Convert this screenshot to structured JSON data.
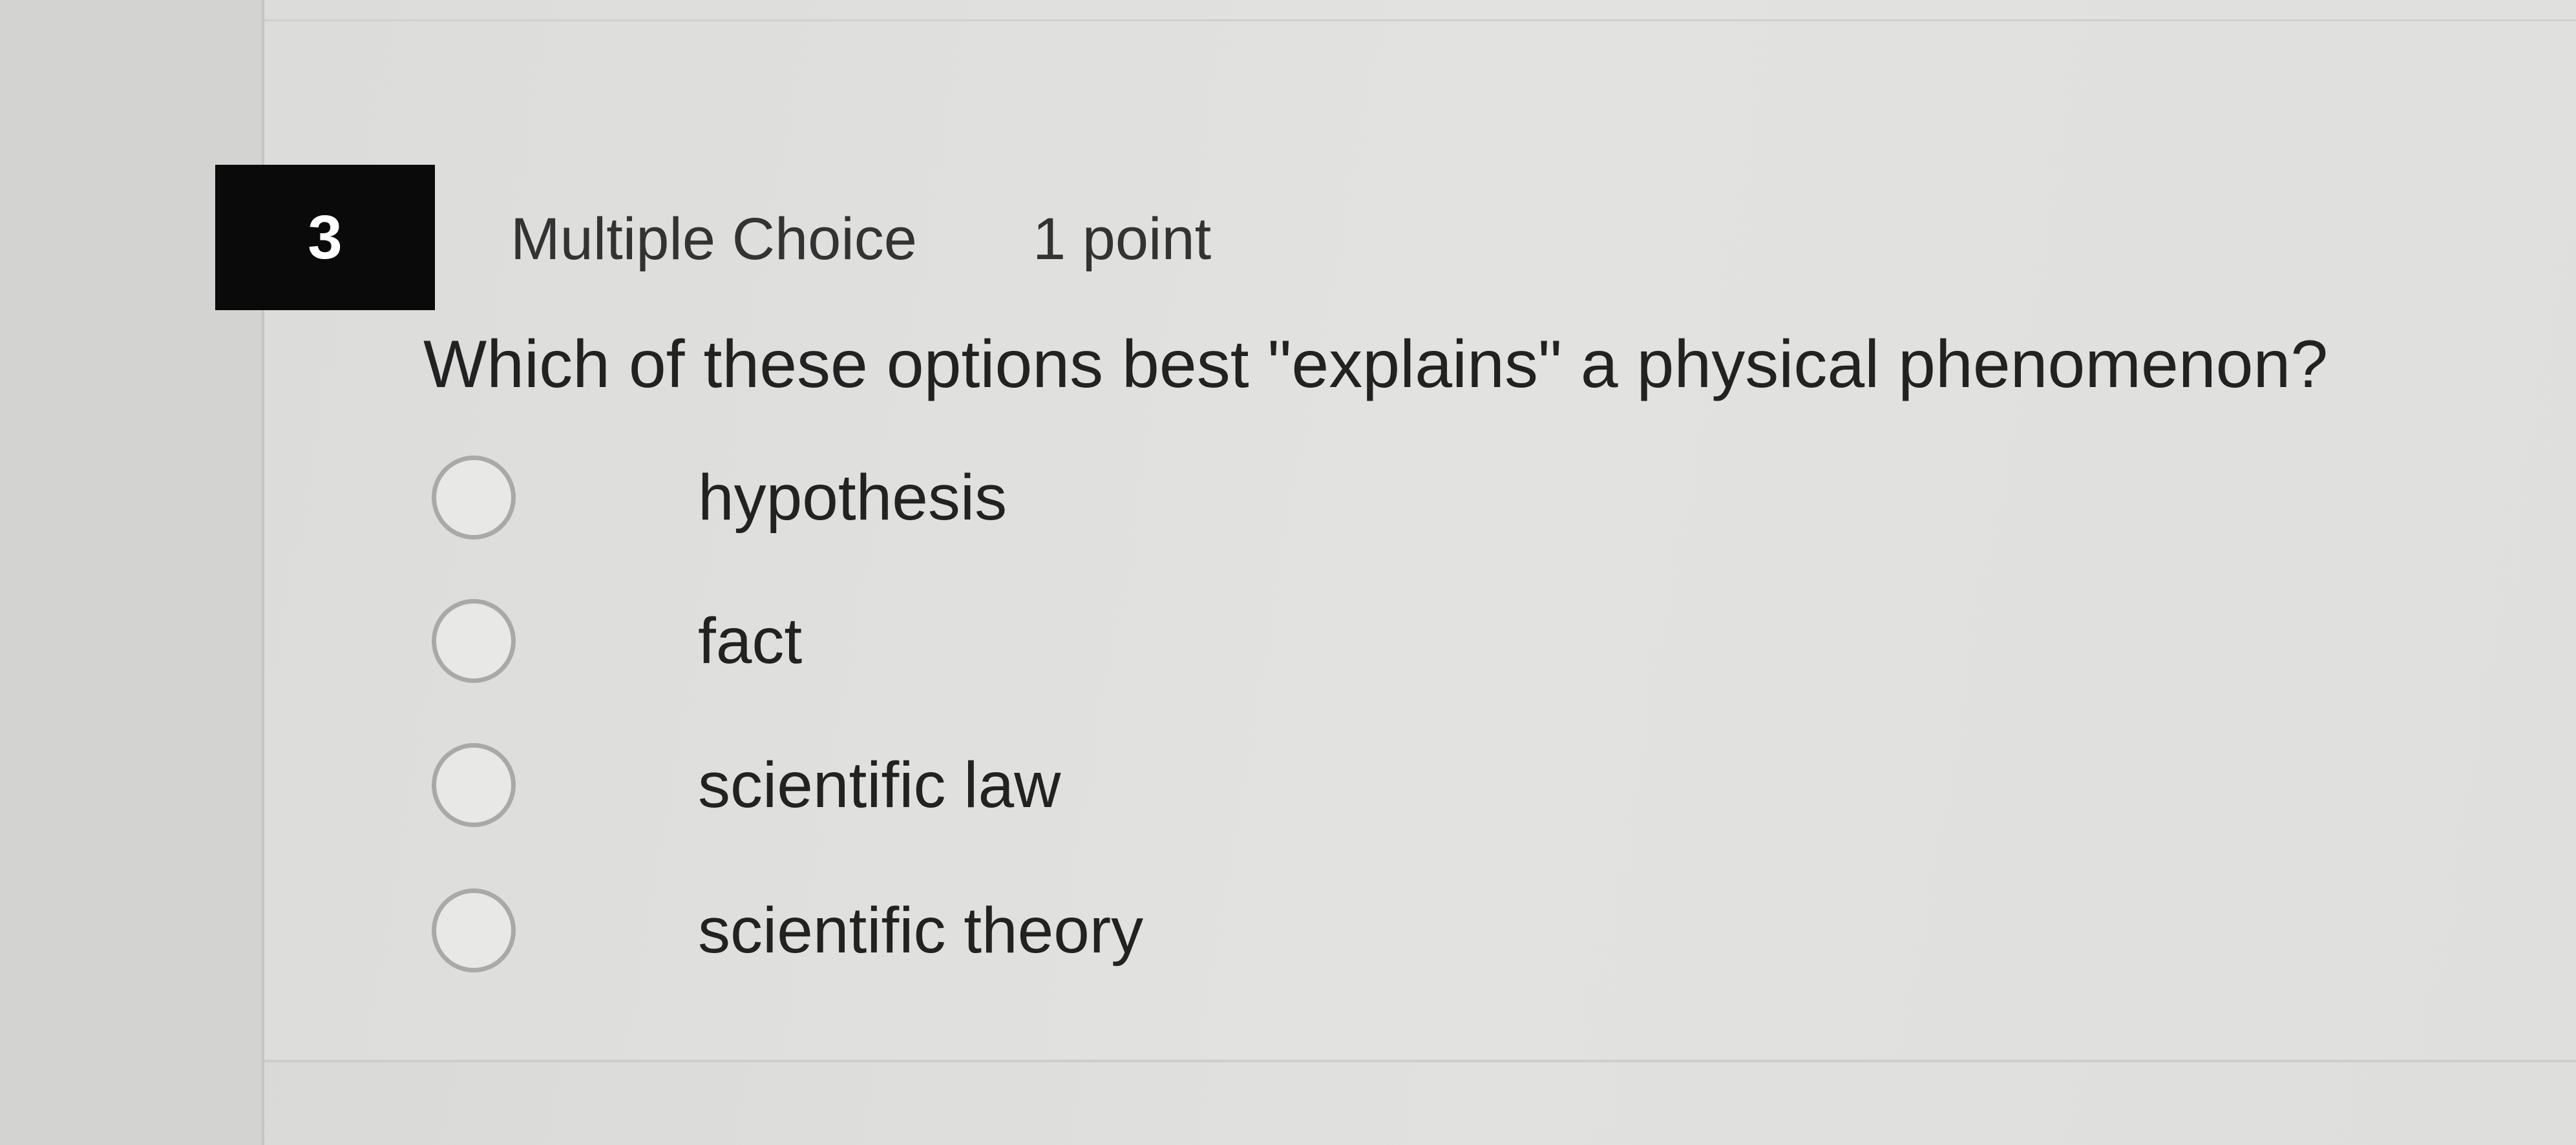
{
  "question": {
    "number": "3",
    "type": "Multiple Choice",
    "points": "1 point",
    "prompt": "Which of these options best \"explains\" a physical phenomenon?",
    "options": [
      {
        "label": "hypothesis",
        "selected": false
      },
      {
        "label": "fact",
        "selected": false
      },
      {
        "label": "scientific law",
        "selected": false
      },
      {
        "label": "scientific theory",
        "selected": false
      }
    ]
  }
}
